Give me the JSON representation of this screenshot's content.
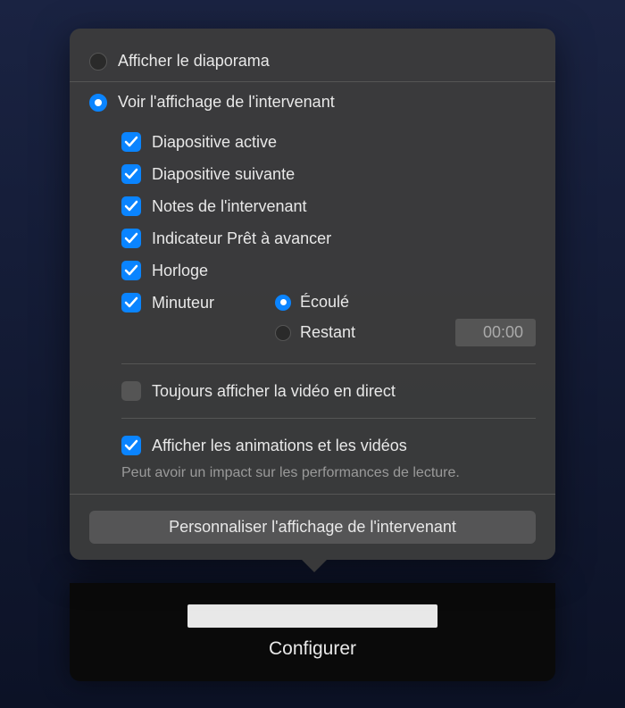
{
  "radios": {
    "show_slideshow": {
      "label": "Afficher le diaporama",
      "selected": false
    },
    "show_presenter": {
      "label": "Voir l'affichage de l'intervenant",
      "selected": true
    }
  },
  "options": {
    "current_slide": {
      "label": "Diapositive active",
      "checked": true
    },
    "next_slide": {
      "label": "Diapositive suivante",
      "checked": true
    },
    "presenter_notes": {
      "label": "Notes de l'intervenant",
      "checked": true
    },
    "ready_indicator": {
      "label": "Indicateur Prêt à avancer",
      "checked": true
    },
    "clock": {
      "label": "Horloge",
      "checked": true
    },
    "timer": {
      "label": "Minuteur",
      "checked": true
    },
    "always_live_video": {
      "label": "Toujours afficher la vidéo en direct",
      "checked": false
    },
    "show_animations": {
      "label": "Afficher les animations et les vidéos",
      "checked": true
    }
  },
  "timer": {
    "elapsed": {
      "label": "Écoulé",
      "selected": true
    },
    "remaining": {
      "label": "Restant",
      "selected": false
    },
    "value": "00:00"
  },
  "hint": "Peut avoir un impact sur les performances de lecture.",
  "buttons": {
    "customize": "Personnaliser l'affichage de l'intervenant"
  },
  "bottom_bar": {
    "label": "Configurer"
  }
}
